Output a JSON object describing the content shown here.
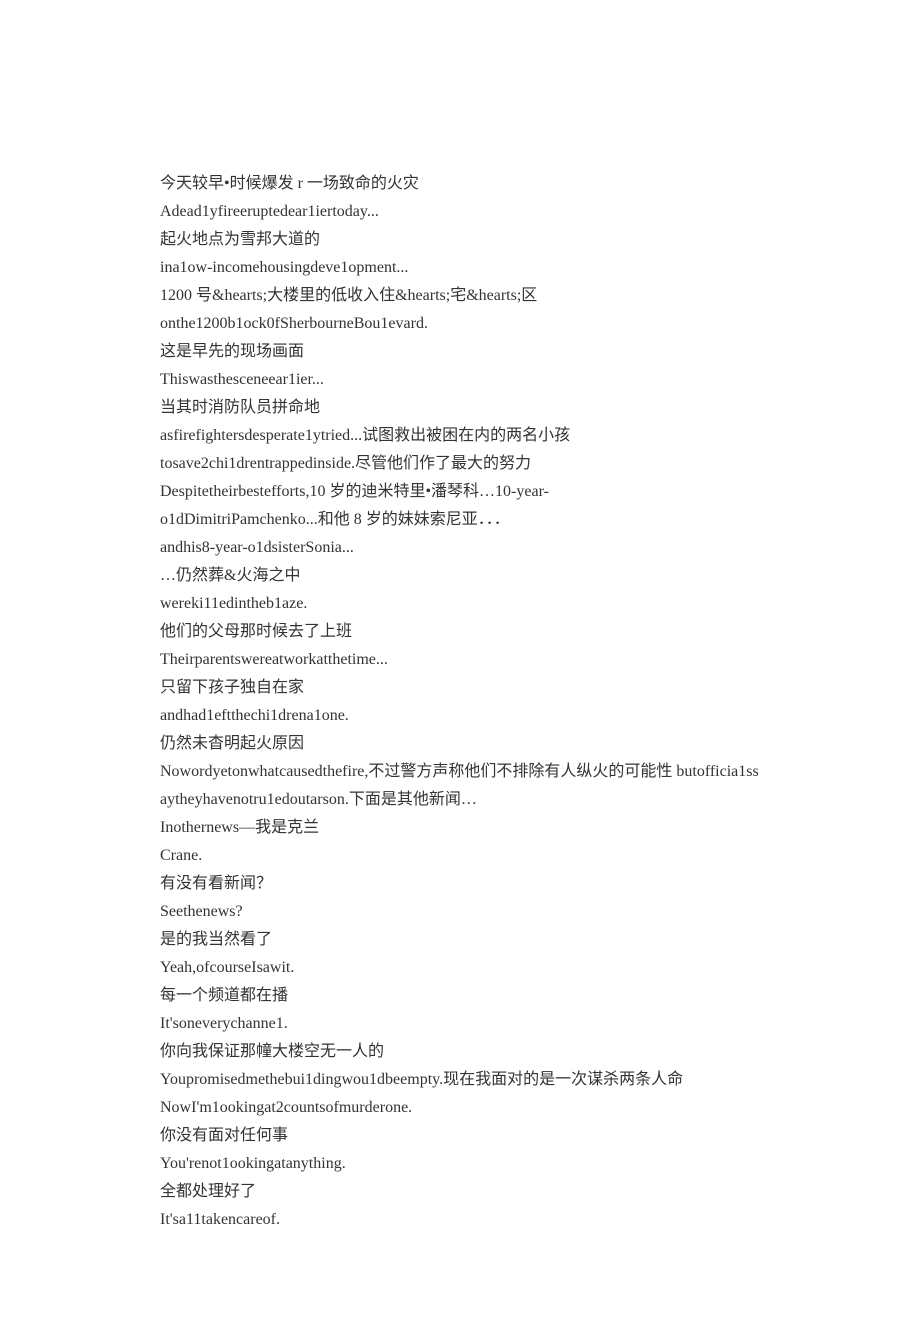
{
  "lines": [
    "今天较早•时候爆发 r 一场致命的火灾",
    "Adead1yfireeruptedear1iertoday...",
    "起火地点为雪邦大道的",
    "ina1ow-incomehousingdeve1opment...",
    "1200 号&hearts;大楼里的低收入住&hearts;宅&hearts;区",
    "onthe1200b1ock0fSherbourneBou1evard.",
    "这是早先的现场画面",
    "Thiswasthesceneear1ier...",
    "当其时消防队员拼命地",
    "asfirefightersdesperate1ytried...试图救出被困在内的两名小孩",
    "tosave2chi1drentrappedinside.尽管他们作了最大的努力",
    "Despitetheirbestefforts,10 岁的迪米特里•潘琴科…10-year-",
    "o1dDimitriPamchenko...和他 8 岁的妹妹索尼亚．．．",
    "andhis8-year-o1dsisterSonia...",
    "…仍然葬&火海之中",
    "wereki11edintheb1aze.",
    "他们的父母那时候去了上班",
    "Theirparentswereatworkatthetime...",
    "只留下孩子独自在家",
    "andhad1eftthechi1drena1one.",
    "仍然未杳明起火原因",
    "Nowordyetonwhatcausedthefire,不过警方声称他们不排除有人纵火的可能性 butofficia1ssaytheyhavenotru1edoutarson.下面是其他新闻…",
    "Inothernews―我是克兰",
    "Crane.",
    "有没有看新闻？",
    "Seethenews?",
    "是的我当然看了",
    "Yeah,ofcourseIsawit.",
    "每一个频道都在播",
    "It'soneverychanne1.",
    "你向我保证那幢大楼空无一人的",
    "Youpromisedmethebui1dingwou1dbeempty.现在我面对的是一次谋杀两条人命",
    "NowI'm1ookingat2countsofmurderone.",
    "你没有面对任何事",
    "You'renot1ookingatanything.",
    "全都处理好了",
    "It'sa11takencareof."
  ]
}
